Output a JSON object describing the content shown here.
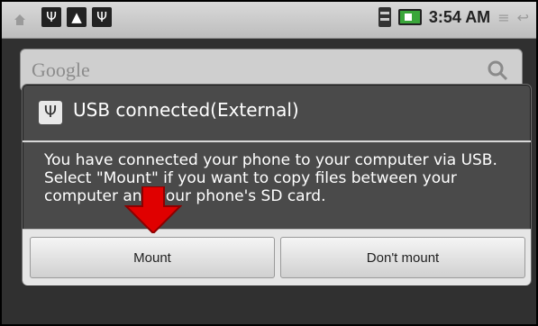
{
  "status_bar": {
    "time": "3:54 AM"
  },
  "search": {
    "placeholder": "Google"
  },
  "dialog": {
    "title": "USB connected(External)",
    "message": "You have connected your phone to your computer via USB. Select \"Mount\" if you want to copy files between your computer and your phone's SD card.",
    "buttons": {
      "mount": "Mount",
      "dont_mount": "Don't mount"
    }
  },
  "colors": {
    "statusbar": "#d0d0d0",
    "dialog_bg": "#4a4a4a",
    "arrow_red": "#e00000",
    "button_bar": "#e6e6e6"
  }
}
